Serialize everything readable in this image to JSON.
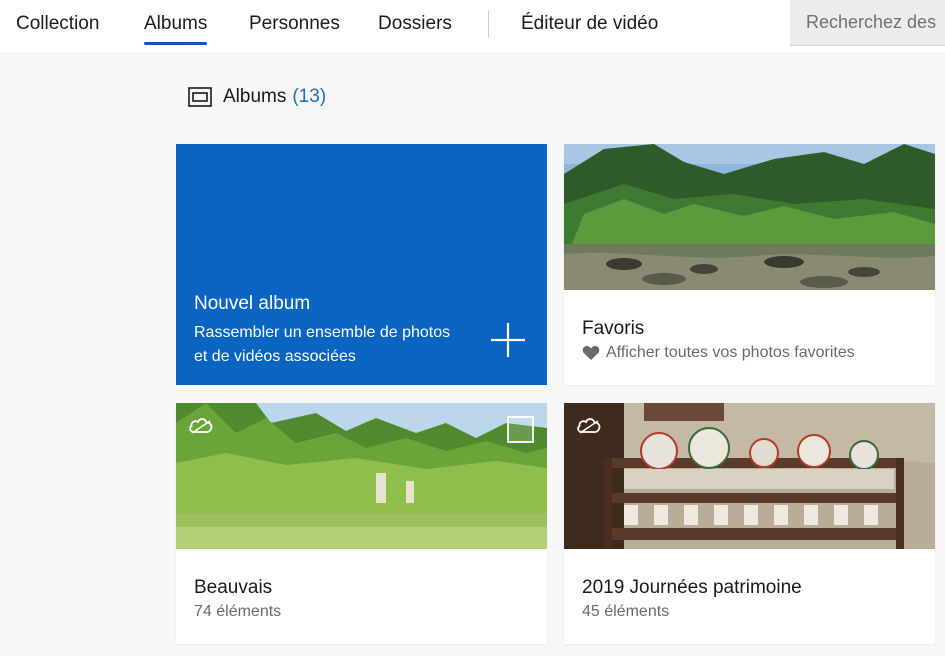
{
  "nav": {
    "items": [
      {
        "label": "Collection",
        "active": false
      },
      {
        "label": "Albums",
        "active": true
      },
      {
        "label": "Personnes",
        "active": false
      },
      {
        "label": "Dossiers",
        "active": false
      }
    ],
    "video_editor": "Éditeur de vidéo",
    "search_placeholder": "Recherchez des"
  },
  "section": {
    "title": "Albums",
    "count": "(13)"
  },
  "new_album": {
    "title": "Nouvel album",
    "subtitle_line1": "Rassembler un ensemble de photos",
    "subtitle_line2": "et de vidéos associées"
  },
  "albums": [
    {
      "title": "Favoris",
      "subtitle": "Afficher toutes vos photos favorites",
      "icon": "heart-icon"
    },
    {
      "title": "Beauvais",
      "subtitle": "74 éléments",
      "icon": "cloud-icon"
    },
    {
      "title": "2019 Journées patrimoine",
      "subtitle": "45 éléments",
      "icon": "cloud-icon"
    }
  ],
  "colors": {
    "accent": "#0a64c2",
    "count": "#1f6fb8",
    "tab_underline": "#0b5cad"
  }
}
